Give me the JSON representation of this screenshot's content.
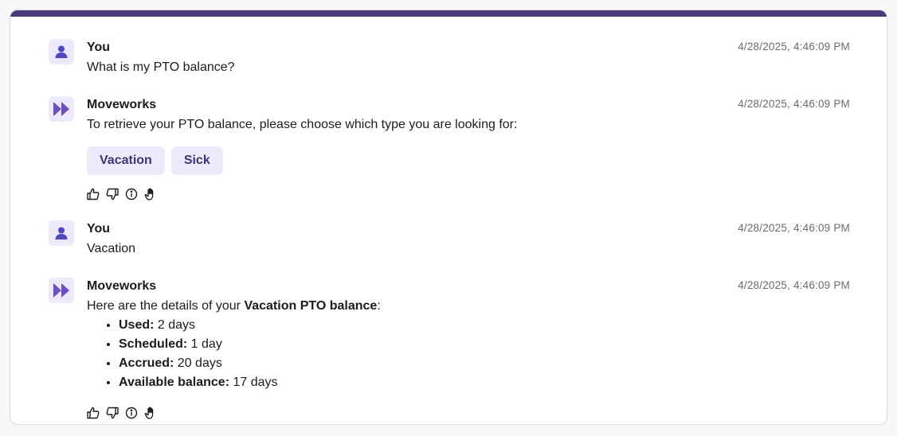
{
  "messages": [
    {
      "sender": "You",
      "time": "4/28/2025, 4:46:09 PM",
      "text": "What is my PTO balance?"
    },
    {
      "sender": "Moveworks",
      "time": "4/28/2025, 4:46:09 PM",
      "text": "To retrieve your PTO balance, please choose which type you are looking for:",
      "chips": [
        "Vacation",
        "Sick"
      ]
    },
    {
      "sender": "You",
      "time": "4/28/2025, 4:46:09 PM",
      "text": "Vacation"
    },
    {
      "sender": "Moveworks",
      "time": "4/28/2025, 4:46:09 PM",
      "intro_prefix": "Here are the details of your ",
      "intro_bold": "Vacation PTO balance",
      "intro_suffix": ":",
      "details": [
        {
          "label": "Used:",
          "value": " 2 days"
        },
        {
          "label": "Scheduled:",
          "value": " 1 day"
        },
        {
          "label": "Accrued:",
          "value": " 20 days"
        },
        {
          "label": "Available balance:",
          "value": " 17 days"
        }
      ]
    }
  ],
  "colors": {
    "accent": "#4b3b7d",
    "chip_bg": "#eeeafb",
    "chip_text": "#3f3475",
    "user_icon": "#4f46c8",
    "bot_icon": "#6c4fc8"
  },
  "icons": {
    "user_avatar": "person-icon",
    "bot_avatar": "fast-forward-icon",
    "actions": [
      "thumbs-up-icon",
      "thumbs-down-icon",
      "info-icon",
      "raise-hand-icon"
    ]
  }
}
